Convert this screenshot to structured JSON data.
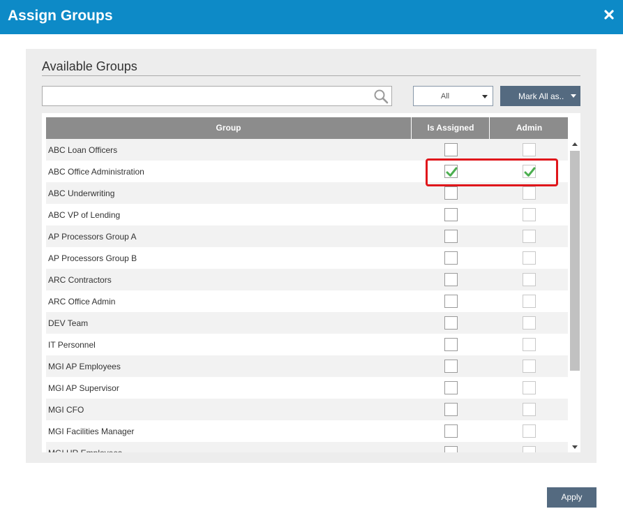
{
  "window": {
    "title": "Assign Groups"
  },
  "panel": {
    "title": "Available Groups"
  },
  "search": {
    "value": "",
    "placeholder": ""
  },
  "filter": {
    "selected": "All"
  },
  "mark_all": {
    "label": "Mark All as.."
  },
  "grid": {
    "columns": [
      "Group",
      "Is Assigned",
      "Admin"
    ],
    "rows": [
      {
        "name": "ABC Loan Officers",
        "assigned": false,
        "admin": false
      },
      {
        "name": "ABC Office Administration",
        "assigned": true,
        "admin": true
      },
      {
        "name": "ABC Underwriting",
        "assigned": false,
        "admin": false
      },
      {
        "name": "ABC VP of Lending",
        "assigned": false,
        "admin": false
      },
      {
        "name": "AP Processors Group A",
        "assigned": false,
        "admin": false
      },
      {
        "name": "AP Processors Group B",
        "assigned": false,
        "admin": false
      },
      {
        "name": "ARC Contractors",
        "assigned": false,
        "admin": false
      },
      {
        "name": "ARC Office Admin",
        "assigned": false,
        "admin": false
      },
      {
        "name": "DEV Team",
        "assigned": false,
        "admin": false
      },
      {
        "name": "IT Personnel",
        "assigned": false,
        "admin": false
      },
      {
        "name": "MGI AP Employees",
        "assigned": false,
        "admin": false
      },
      {
        "name": "MGI AP Supervisor",
        "assigned": false,
        "admin": false
      },
      {
        "name": "MGI CFO",
        "assigned": false,
        "admin": false
      },
      {
        "name": "MGI Facilities Manager",
        "assigned": false,
        "admin": false
      },
      {
        "name": "MGI HR Employees",
        "assigned": false,
        "admin": false
      }
    ]
  },
  "buttons": {
    "apply": "Apply"
  },
  "colors": {
    "titlebar": "#0d8ac7",
    "button": "#546a80",
    "check": "#4caf50",
    "highlight": "#e0161b"
  },
  "icons": {
    "close": "close-icon",
    "search": "search-icon"
  }
}
